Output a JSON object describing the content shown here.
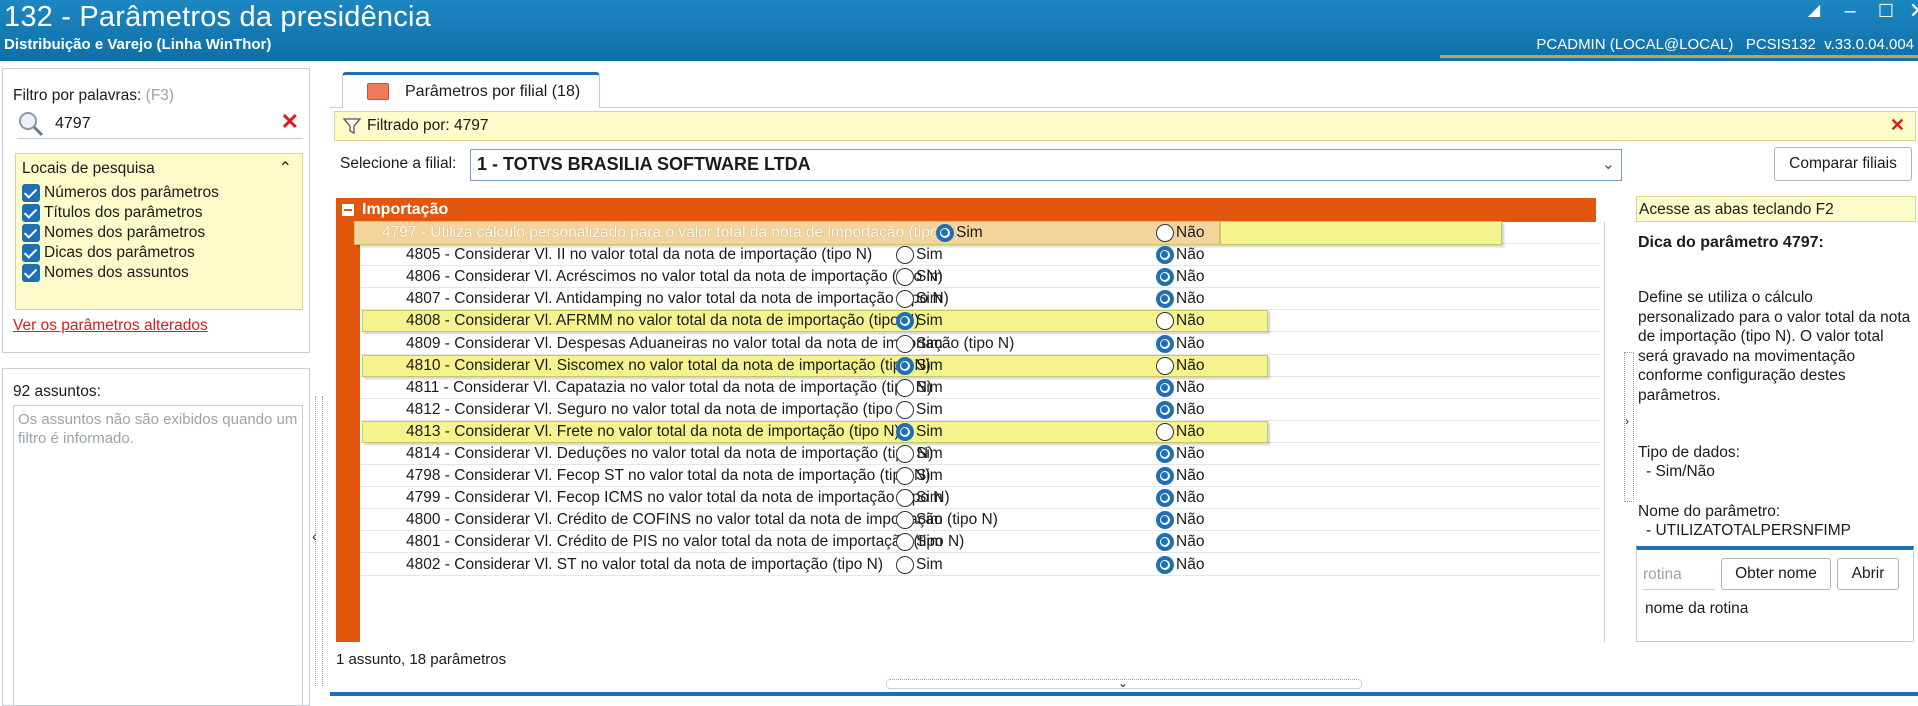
{
  "window": {
    "title": "132 - Parâmetros da presidência",
    "subtitle": "Distribuição e Varejo (Linha WinThor)",
    "user_info": "PCADMIN (LOCAL@LOCAL)   PCSIS132  v.33.0.04.004"
  },
  "filter_panel": {
    "label": "Filtro por palavras:",
    "shortcut": "(F3)",
    "search_value": "4797",
    "locais_title": "Locais de pesquisa",
    "options": [
      {
        "label": "Números dos parâmetros",
        "checked": true
      },
      {
        "label": "Títulos dos parâmetros",
        "checked": true
      },
      {
        "label": "Nomes dos parâmetros",
        "checked": true
      },
      {
        "label": "Dicas dos parâmetros",
        "checked": true
      },
      {
        "label": "Nomes dos assuntos",
        "checked": true
      }
    ],
    "changed_link": "Ver os parâmetros alterados"
  },
  "subjects_panel": {
    "count": "92 assuntos:",
    "note": "Os assuntos não são exibidos quando um filtro é informado."
  },
  "main": {
    "tab_label": "Parâmetros por filial  (18)",
    "filter_banner": "Filtrado por: 4797",
    "branch_label": "Selecione a filial:",
    "branch_value": "1 - TOTVS BRASILIA SOFTWARE LTDA",
    "compare_button": "Comparar filiais",
    "group_title": "Importação",
    "option_sim": "Sim",
    "option_nao": "Não",
    "rows": [
      {
        "text": "4797 - Utiliza cálculo personalizado para o valor total da nota de importação (tipo N)",
        "value": "Sim",
        "highlight": true,
        "selected": true
      },
      {
        "text": "4805 - Considerar Vl. II no valor total da nota de importação (tipo N)",
        "value": "Não",
        "highlight": false
      },
      {
        "text": "4806 - Considerar Vl. Acréscimos no valor total da nota de importação (tipo N)",
        "value": "Não",
        "highlight": false
      },
      {
        "text": "4807 - Considerar Vl. Antidamping no valor total da nota de importação (tipo N)",
        "value": "Não",
        "highlight": false
      },
      {
        "text": "4808 - Considerar Vl. AFRMM no valor total da nota de importação (tipo N)",
        "value": "Sim",
        "highlight": true
      },
      {
        "text": "4809 - Considerar Vl. Despesas Aduaneiras no valor total da nota de importação (tipo N)",
        "value": "Não",
        "highlight": false
      },
      {
        "text": "4810 - Considerar Vl. Siscomex no valor total da nota de importação (tipo N)",
        "value": "Sim",
        "highlight": true
      },
      {
        "text": "4811 - Considerar Vl. Capatazia no valor total da nota de importação (tipo N)",
        "value": "Não",
        "highlight": false
      },
      {
        "text": "4812 - Considerar Vl. Seguro no valor total da nota de importação (tipo N)",
        "value": "Não",
        "highlight": false
      },
      {
        "text": "4813 - Considerar Vl. Frete no valor total da nota de importação (tipo N)",
        "value": "Sim",
        "highlight": true
      },
      {
        "text": "4814 - Considerar Vl. Deduções no valor total da nota de importação (tipo N)",
        "value": "Não",
        "highlight": false
      },
      {
        "text": "4798 - Considerar Vl. Fecop ST no valor total da nota de importação (tipo N)",
        "value": "Não",
        "highlight": false
      },
      {
        "text": "4799 - Considerar Vl. Fecop ICMS  no valor total da nota de importação (tipo N)",
        "value": "Não",
        "highlight": false
      },
      {
        "text": "4800 - Considerar Vl. Crédito de COFINS no valor total da nota de importação (tipo N)",
        "value": "Não",
        "highlight": false
      },
      {
        "text": "4801 - Considerar Vl. Crédito de PIS no valor total da nota de importação (tipo N)",
        "value": "Não",
        "highlight": false
      },
      {
        "text": "4802 - Considerar Vl. ST no valor total da nota de importação (tipo N)",
        "value": "Não",
        "highlight": false
      }
    ],
    "footer": "1 assunto, 18 parâmetros"
  },
  "hint_panel": {
    "key_hint": "Acesse as abas teclando F2",
    "tip_title": "Dica do parâmetro 4797:",
    "tip_body": "Define se utiliza o cálculo personalizado para o valor total da nota de importação (tipo N). O valor total será gravado na movimentação conforme configuração destes parâmetros.",
    "type_label": "Tipo de dados:",
    "type_value": "- Sim/Não",
    "name_label": "Nome do parâmetro:",
    "name_value": "- UTILIZATOTALPERSNFIMP",
    "rotina_placeholder": "rotina",
    "obter_button": "Obter nome",
    "abrir_button": "Abrir",
    "rotina_name": "nome da rotina"
  },
  "colors": {
    "title_bar": "#1c87c2",
    "group_header": "#e2560e",
    "highlight": "#f4f38e",
    "accent": "#1f6fb5",
    "link": "#d71d1d"
  }
}
